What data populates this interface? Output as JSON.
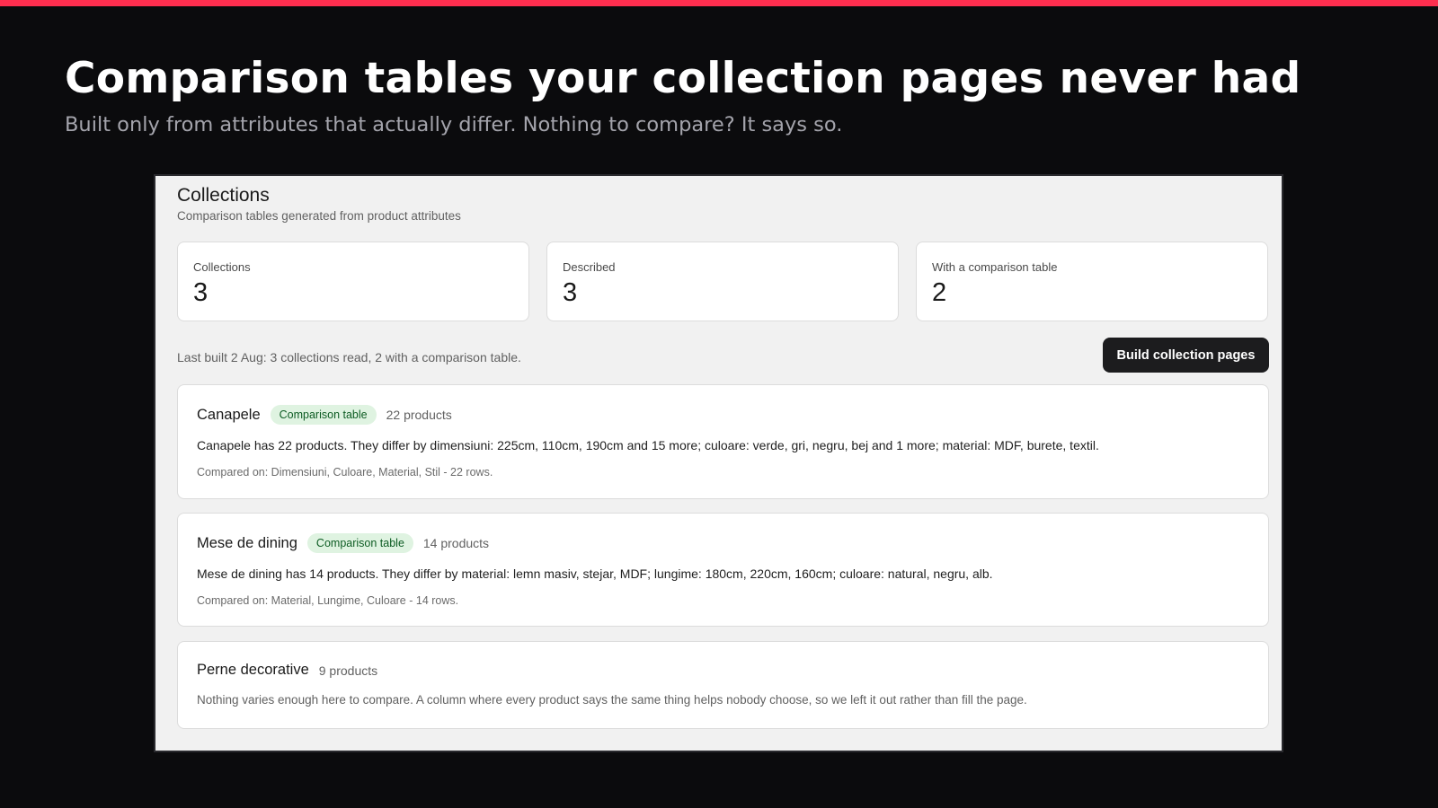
{
  "hero": {
    "title": "Comparison tables your collection pages never had",
    "subtitle": "Built only from attributes that actually differ. Nothing to compare? It says so."
  },
  "app": {
    "title": "Collections",
    "subtitle": "Comparison tables generated from product attributes",
    "stats": [
      {
        "label": "Collections",
        "value": "3"
      },
      {
        "label": "Described",
        "value": "3"
      },
      {
        "label": "With a comparison table",
        "value": "2"
      }
    ],
    "last_built": "Last built 2 Aug: 3 collections read, 2 with a comparison table.",
    "build_button": "Build collection pages",
    "collections": [
      {
        "name": "Canapele",
        "badge": "Comparison table",
        "count": "22 products",
        "description": "Canapele has 22 products. They differ by dimensiuni: 225cm, 110cm, 190cm and 15 more; culoare: verde, gri, negru, bej and 1 more; material: MDF, burete, textil.",
        "compared": "Compared on: Dimensiuni, Culoare, Material, Stil - 22 rows."
      },
      {
        "name": "Mese de dining",
        "badge": "Comparison table",
        "count": "14 products",
        "description": "Mese de dining has 14 products. They differ by material: lemn masiv, stejar, MDF; lungime: 180cm, 220cm, 160cm; culoare: natural, negru, alb.",
        "compared": "Compared on: Material, Lungime, Culoare - 14 rows."
      },
      {
        "name": "Perne decorative",
        "count": "9 products",
        "note": "Nothing varies enough here to compare. A column where every product says the same thing helps nobody choose, so we left it out rather than fill the page."
      }
    ]
  },
  "colors": {
    "accent": "#ff2e4f",
    "background": "#0b0b0d",
    "badge_bg": "#dff3e1",
    "badge_text": "#0d5c23",
    "button_bg": "#1c1c1e"
  }
}
